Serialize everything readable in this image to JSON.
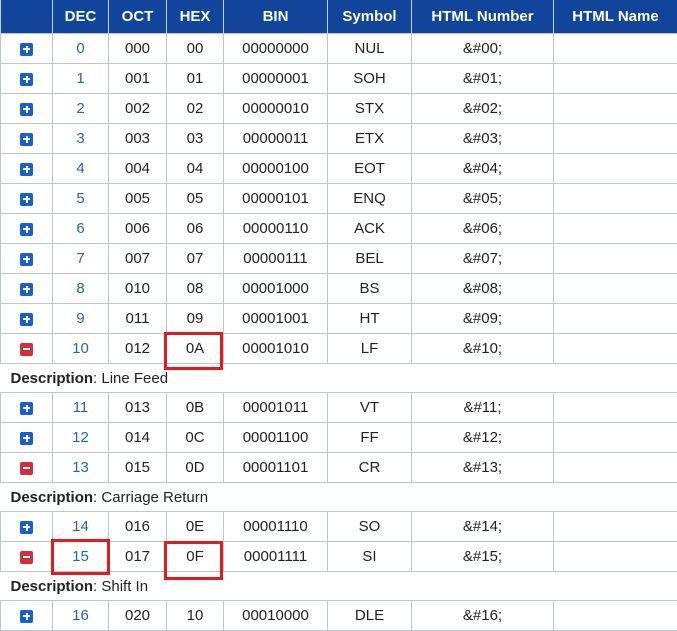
{
  "columns": [
    "",
    "DEC",
    "OCT",
    "HEX",
    "BIN",
    "Symbol",
    "HTML Number",
    "HTML Name"
  ],
  "description_label": "Description",
  "rows": [
    {
      "dec": "0",
      "oct": "000",
      "hex": "00",
      "bin": "00000000",
      "symbol": "NUL",
      "html_number": "&#00;",
      "html_name": "",
      "expanded": false
    },
    {
      "dec": "1",
      "oct": "001",
      "hex": "01",
      "bin": "00000001",
      "symbol": "SOH",
      "html_number": "&#01;",
      "html_name": "",
      "expanded": false
    },
    {
      "dec": "2",
      "oct": "002",
      "hex": "02",
      "bin": "00000010",
      "symbol": "STX",
      "html_number": "&#02;",
      "html_name": "",
      "expanded": false
    },
    {
      "dec": "3",
      "oct": "003",
      "hex": "03",
      "bin": "00000011",
      "symbol": "ETX",
      "html_number": "&#03;",
      "html_name": "",
      "expanded": false
    },
    {
      "dec": "4",
      "oct": "004",
      "hex": "04",
      "bin": "00000100",
      "symbol": "EOT",
      "html_number": "&#04;",
      "html_name": "",
      "expanded": false
    },
    {
      "dec": "5",
      "oct": "005",
      "hex": "05",
      "bin": "00000101",
      "symbol": "ENQ",
      "html_number": "&#05;",
      "html_name": "",
      "expanded": false
    },
    {
      "dec": "6",
      "oct": "006",
      "hex": "06",
      "bin": "00000110",
      "symbol": "ACK",
      "html_number": "&#06;",
      "html_name": "",
      "expanded": false
    },
    {
      "dec": "7",
      "oct": "007",
      "hex": "07",
      "bin": "00000111",
      "symbol": "BEL",
      "html_number": "&#07;",
      "html_name": "",
      "expanded": false
    },
    {
      "dec": "8",
      "oct": "010",
      "hex": "08",
      "bin": "00001000",
      "symbol": "BS",
      "html_number": "&#08;",
      "html_name": "",
      "expanded": false
    },
    {
      "dec": "9",
      "oct": "011",
      "hex": "09",
      "bin": "00001001",
      "symbol": "HT",
      "html_number": "&#09;",
      "html_name": "",
      "expanded": false
    },
    {
      "dec": "10",
      "oct": "012",
      "hex": "0A",
      "bin": "00001010",
      "symbol": "LF",
      "html_number": "&#10;",
      "html_name": "",
      "expanded": true,
      "description": "Line Feed"
    },
    {
      "dec": "11",
      "oct": "013",
      "hex": "0B",
      "bin": "00001011",
      "symbol": "VT",
      "html_number": "&#11;",
      "html_name": "",
      "expanded": false
    },
    {
      "dec": "12",
      "oct": "014",
      "hex": "0C",
      "bin": "00001100",
      "symbol": "FF",
      "html_number": "&#12;",
      "html_name": "",
      "expanded": false
    },
    {
      "dec": "13",
      "oct": "015",
      "hex": "0D",
      "bin": "00001101",
      "symbol": "CR",
      "html_number": "&#13;",
      "html_name": "",
      "expanded": true,
      "description": "Carriage Return"
    },
    {
      "dec": "14",
      "oct": "016",
      "hex": "0E",
      "bin": "00001110",
      "symbol": "SO",
      "html_number": "&#14;",
      "html_name": "",
      "expanded": false
    },
    {
      "dec": "15",
      "oct": "017",
      "hex": "0F",
      "bin": "00001111",
      "symbol": "SI",
      "html_number": "&#15;",
      "html_name": "",
      "expanded": true,
      "description": "Shift In"
    },
    {
      "dec": "16",
      "oct": "020",
      "hex": "10",
      "bin": "00010000",
      "symbol": "DLE",
      "html_number": "&#16;",
      "html_name": "",
      "expanded": false
    }
  ],
  "highlight_color": "#e21b23",
  "icons": {
    "expand": "plus-square-icon",
    "collapse": "minus-square-icon"
  }
}
